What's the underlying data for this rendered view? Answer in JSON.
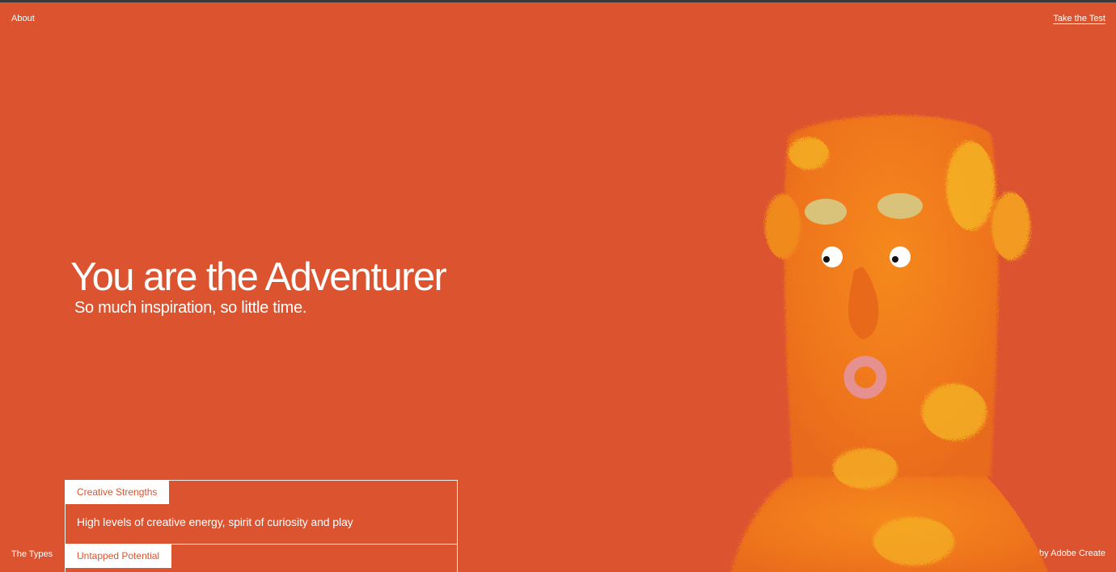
{
  "header": {
    "about_label": "About",
    "cta_label": "Take the Test"
  },
  "hero": {
    "title": "You are the Adventurer",
    "subtitle": "So much inspiration, so little time."
  },
  "traits": [
    {
      "label": "Creative Strengths",
      "description": "High levels of creative energy, spirit of curiosity and play"
    },
    {
      "label": "Untapped Potential",
      "description": ""
    }
  ],
  "footer": {
    "types_label": "The Types",
    "brand_label": "by Adobe Create"
  },
  "illustration": {
    "name": "fuzzy-orange-creature",
    "colors": {
      "fur": "#f07a1a",
      "fur_light": "#f4a722",
      "brow": "#d9c27a",
      "mouth": "#e79090"
    }
  },
  "colors": {
    "background": "#dc532f",
    "text": "#ffffff"
  }
}
